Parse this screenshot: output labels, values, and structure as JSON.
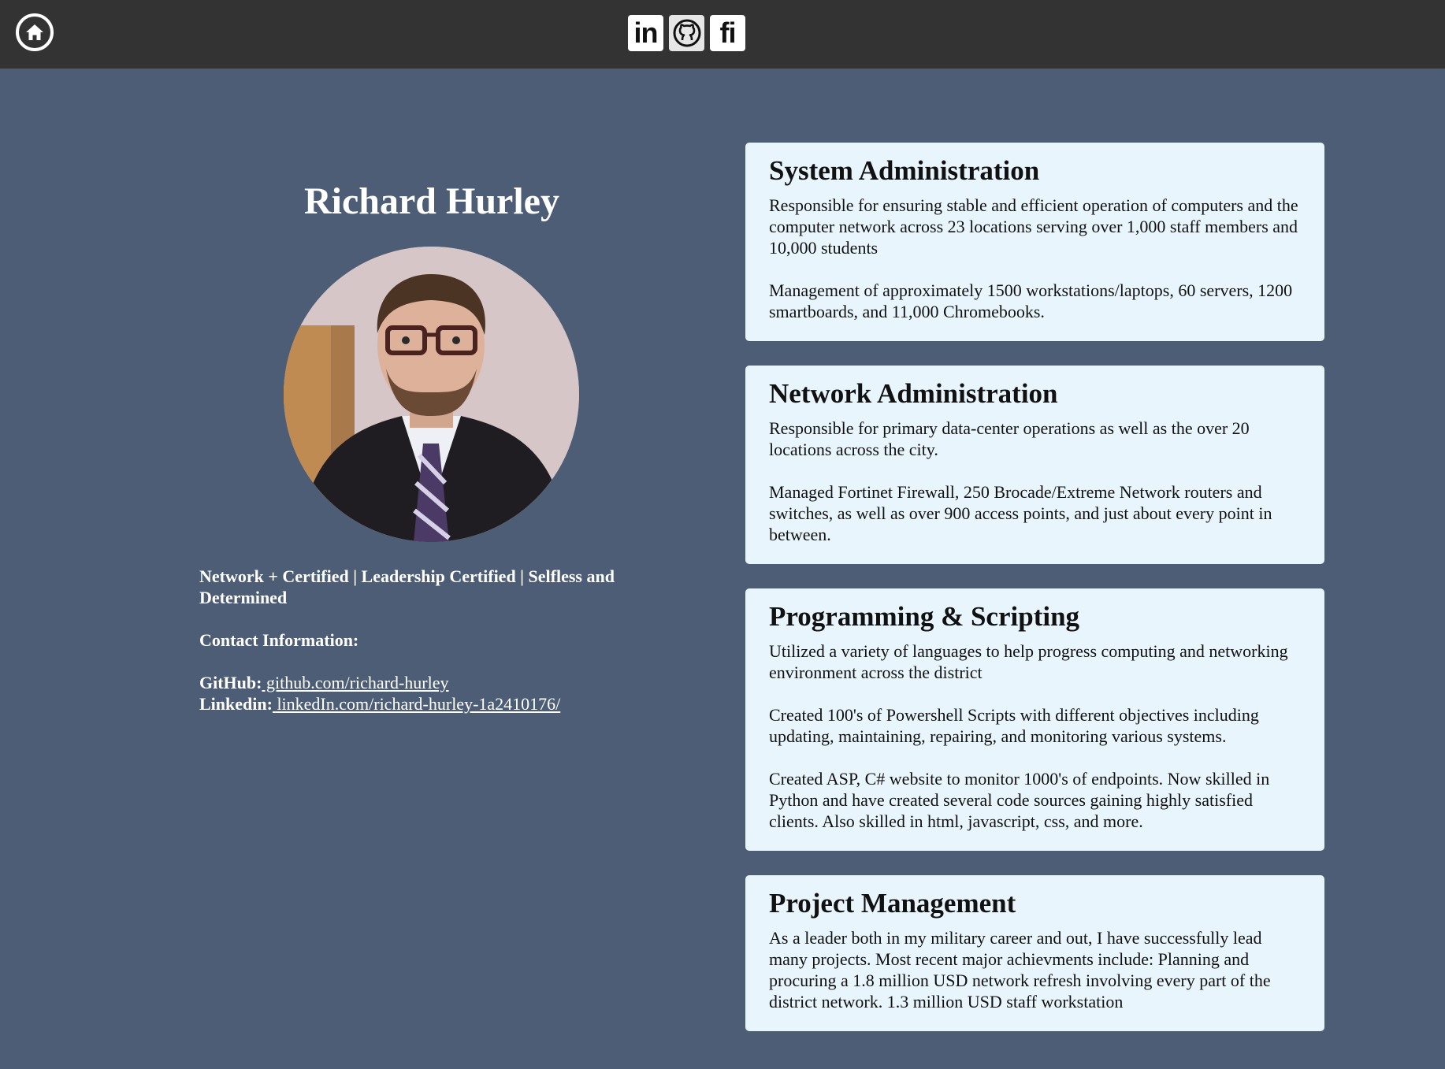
{
  "header": {
    "home_icon": "home-icon",
    "social": [
      {
        "name": "linkedin-icon",
        "glyph": "in"
      },
      {
        "name": "github-icon",
        "glyph": "github"
      },
      {
        "name": "fiverr-icon",
        "glyph": "fi"
      }
    ],
    "colors": {
      "bar": "#333333",
      "page": "#4d5d75",
      "card": "#e8f5fd"
    }
  },
  "profile": {
    "name": "Richard Hurley",
    "tagline": "Network + Certified | Leadership Certified | Selfless and Determined",
    "contact_heading": "Contact Information:",
    "github_label": "GitHub:",
    "github_link": " github.com/richard-hurley",
    "linkedin_label": "Linkedin:",
    "linkedin_link": " linkedIn.com/richard-hurley-1a2410176/"
  },
  "cards": [
    {
      "title": "System Administration",
      "paragraphs": [
        "Responsible for ensuring stable and efficient operation of computers and the computer network across 23 locations serving over 1,000 staff members and 10,000 students",
        "Management of approximately 1500 workstations/laptops, 60 servers, 1200 smartboards, and 11,000 Chromebooks."
      ]
    },
    {
      "title": "Network Administration",
      "paragraphs": [
        "Responsible for primary data-center operations as well as the over 20 locations across the city.",
        "Managed Fortinet Firewall, 250 Brocade/Extreme Network routers and switches, as well as over 900 access points, and just about every point in between."
      ]
    },
    {
      "title": "Programming & Scripting",
      "paragraphs": [
        "Utilized a variety of languages to help progress computing and networking environment across the district",
        "Created 100's of Powershell Scripts with different objectives including updating, maintaining, repairing, and monitoring various systems.",
        "Created ASP, C# website to monitor 1000's of endpoints. Now skilled in Python and have created several code sources gaining highly satisfied clients. Also skilled in html, javascript, css, and more."
      ]
    },
    {
      "title": "Project Management",
      "paragraphs": [
        "As a leader both in my military career and out, I have successfully lead many projects. Most recent major achievments include: Planning and procuring a 1.8 million USD network refresh involving every part of the district network. 1.3 million USD staff workstation"
      ]
    }
  ]
}
